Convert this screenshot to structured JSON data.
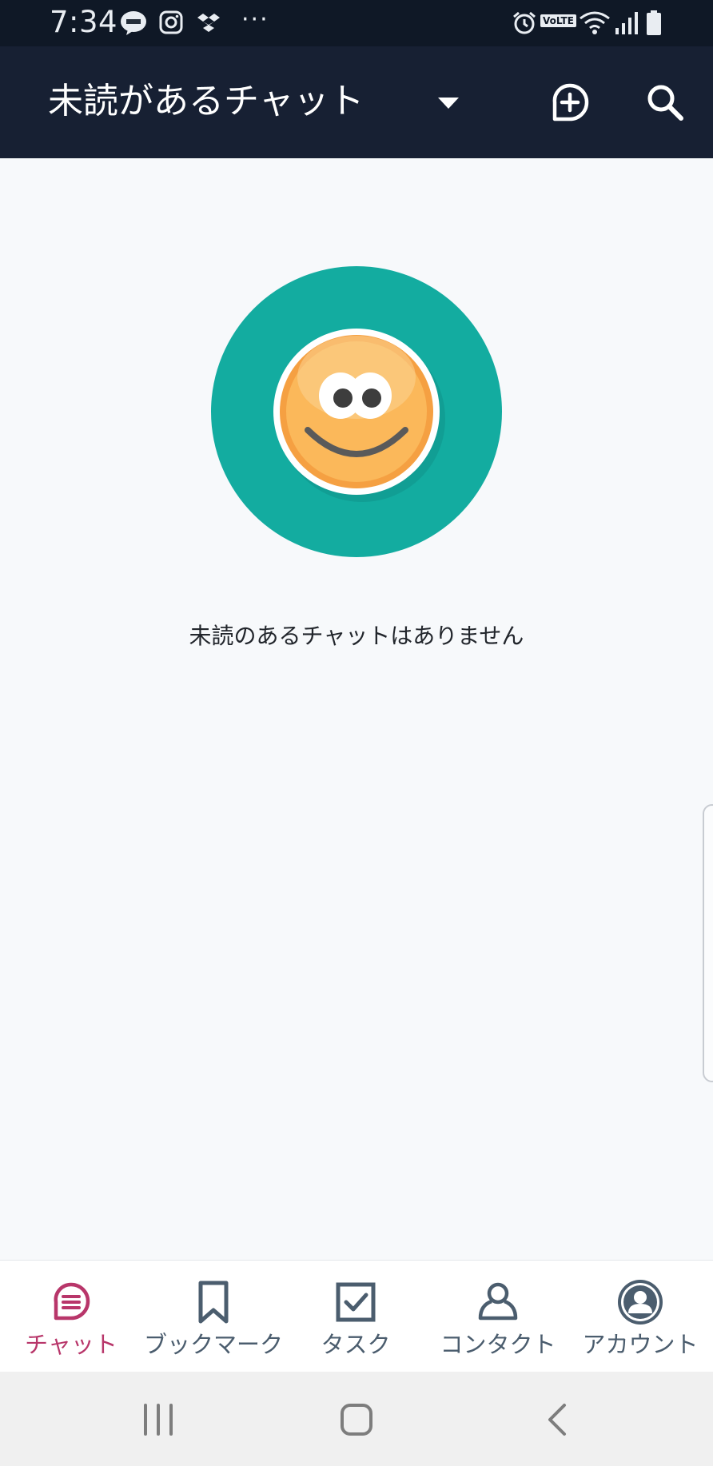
{
  "status_bar": {
    "time": "7:34",
    "icons": [
      "line-icon",
      "instagram-icon",
      "dropbox-icon",
      "more-icon",
      "alarm-icon",
      "volte-icon",
      "wifi-icon",
      "signal-icon",
      "battery-icon"
    ],
    "volte_label": "VoLTE",
    "more_label": "···"
  },
  "header": {
    "title": "未読があるチャット",
    "icons": [
      "dropdown-arrow-icon",
      "add-chat-icon",
      "search-icon"
    ],
    "background": "#172033"
  },
  "empty_state": {
    "message": "未読のあるチャットはありません",
    "illustration": "smiley-face-icon",
    "colors": {
      "circle": "#13aca0",
      "face": "#f7a63c"
    }
  },
  "bottom_nav": {
    "active_color": "#b8366a",
    "inactive_color": "#4b5d6e",
    "items": [
      {
        "label": "チャット",
        "icon": "chat-icon",
        "active": true
      },
      {
        "label": "ブックマーク",
        "icon": "bookmark-icon",
        "active": false
      },
      {
        "label": "タスク",
        "icon": "task-check-icon",
        "active": false
      },
      {
        "label": "コンタクト",
        "icon": "contact-icon",
        "active": false
      },
      {
        "label": "アカウント",
        "icon": "account-icon",
        "active": false
      }
    ]
  },
  "system_nav": {
    "buttons": [
      "recent-apps-icon",
      "home-icon",
      "back-icon"
    ]
  }
}
